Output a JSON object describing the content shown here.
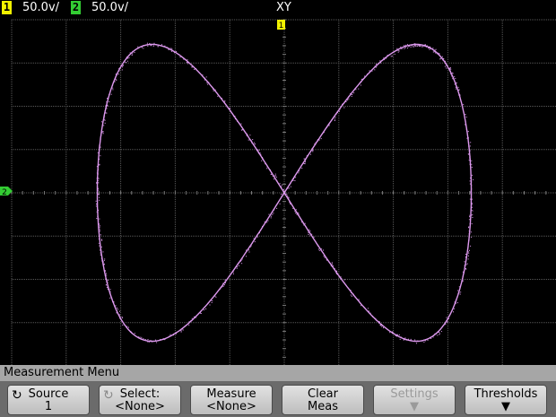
{
  "header": {
    "ch1_num": "1",
    "ch1_scale": "50.0v/",
    "ch2_num": "2",
    "ch2_scale": "50.0v/",
    "mode": "XY",
    "ch1_color": "#f2f200",
    "ch2_color": "#33cc33"
  },
  "markers": {
    "trigger_top": "1",
    "ch2_ground": "2"
  },
  "trace": {
    "color": "#dd99ee",
    "shape": "lissajous-1-2",
    "x_amplitude_divisions": 3.5,
    "y_amplitude_divisions": 3.5
  },
  "grid": {
    "columns": 10,
    "rows": 8,
    "color": "#5a5a5a"
  },
  "menu": {
    "title": "Measurement Menu",
    "keys": [
      {
        "l1": "Source",
        "l2": "1",
        "rot": "↻",
        "dim": false
      },
      {
        "l1": "Select:",
        "l2": "<None>",
        "rot": "↻",
        "dim": false
      },
      {
        "l1": "Measure",
        "l2": "<None>",
        "rot": "",
        "dim": false
      },
      {
        "l1": "Clear",
        "l2": "Meas",
        "rot": "",
        "dim": false
      },
      {
        "l1": "Settings",
        "l2": "▼",
        "rot": "",
        "dim": true
      },
      {
        "l1": "Thresholds",
        "l2": "▼",
        "rot": "",
        "dim": false
      }
    ]
  }
}
